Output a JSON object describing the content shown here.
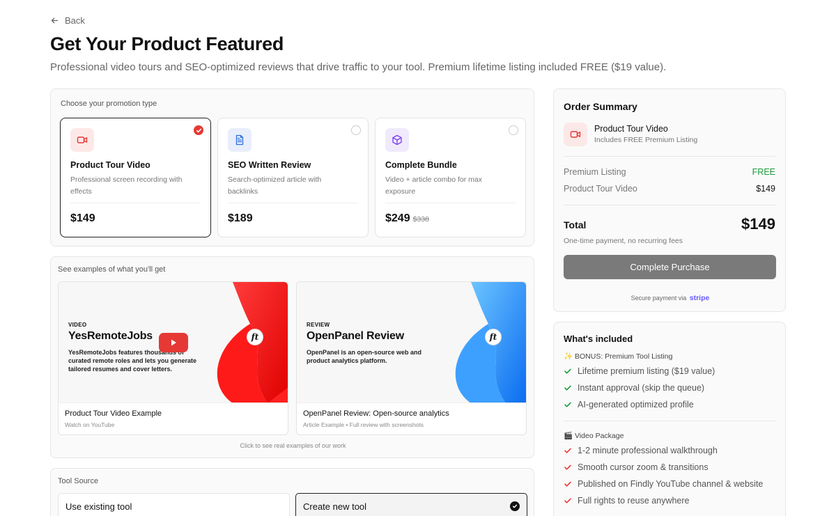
{
  "back": {
    "label": "Back"
  },
  "page": {
    "title": "Get Your Product Featured",
    "subtitle": "Professional video tours and SEO-optimized reviews that drive traffic to your tool. Premium lifetime listing included FREE ($19 value)."
  },
  "promotion": {
    "label": "Choose your promotion type",
    "options": [
      {
        "title": "Product Tour Video",
        "description": "Professional screen recording with effects",
        "price": "$149",
        "old_price": "",
        "icon": "video-icon",
        "color": "#e53935",
        "selected": true
      },
      {
        "title": "SEO Written Review",
        "description": "Search-optimized article with backlinks",
        "price": "$189",
        "old_price": "",
        "icon": "document-icon",
        "color": "#2f6fe0",
        "selected": false
      },
      {
        "title": "Complete Bundle",
        "description": "Video + article combo for max exposure",
        "price": "$249",
        "old_price": "$338",
        "icon": "package-icon",
        "color": "#7c3aed",
        "selected": false
      }
    ]
  },
  "examples": {
    "label": "See examples of what you'll get",
    "items": [
      {
        "kicker": "VIDEO",
        "headline": "YesRemoteJobs",
        "body": "YesRemoteJobs features thousands of curated remote roles and lets you generate tailored resumes and cover letters.",
        "caption": "Product Tour Video Example",
        "sub": "Watch on YouTube",
        "badge": "ft",
        "accent": "#ff1a1a"
      },
      {
        "kicker": "REVIEW",
        "headline": "OpenPanel Review",
        "body": "OpenPanel is an open-source web and product analytics platform.",
        "caption": "OpenPanel Review: Open-source analytics",
        "sub": "Article Example • Full review with screenshots",
        "badge": "ft",
        "accent": "#1a8cff"
      }
    ],
    "hint": "Click to see real examples of our work"
  },
  "tool_source": {
    "label": "Tool Source",
    "options": [
      {
        "label": "Use existing tool",
        "selected": false
      },
      {
        "label": "Create new tool",
        "selected": true
      }
    ]
  },
  "summary": {
    "title": "Order Summary",
    "item_name": "Product Tour Video",
    "item_sub": "Includes FREE Premium Listing",
    "rows": [
      {
        "label": "Premium Listing",
        "value": "FREE"
      },
      {
        "label": "Product Tour Video",
        "value": "$149"
      }
    ],
    "total_label": "Total",
    "total_value": "$149",
    "note": "One-time payment, no recurring fees",
    "button": "Complete Purchase",
    "secure_text": "Secure payment via",
    "secure_brand": "stripe"
  },
  "included": {
    "title": "What's included",
    "bonus_group": "✨ BONUS: Premium Tool Listing",
    "bonus_items": [
      "Lifetime premium listing ($19 value)",
      "Instant approval (skip the queue)",
      "AI-generated optimized profile"
    ],
    "video_group": "🎬 Video Package",
    "video_items": [
      "1-2 minute professional walkthrough",
      "Smooth cursor zoom & transitions",
      "Published on Findly YouTube channel & website",
      "Full rights to reuse anywhere"
    ],
    "colors": {
      "bonus_check": "#1a9a3a",
      "video_check": "#e53935"
    }
  }
}
